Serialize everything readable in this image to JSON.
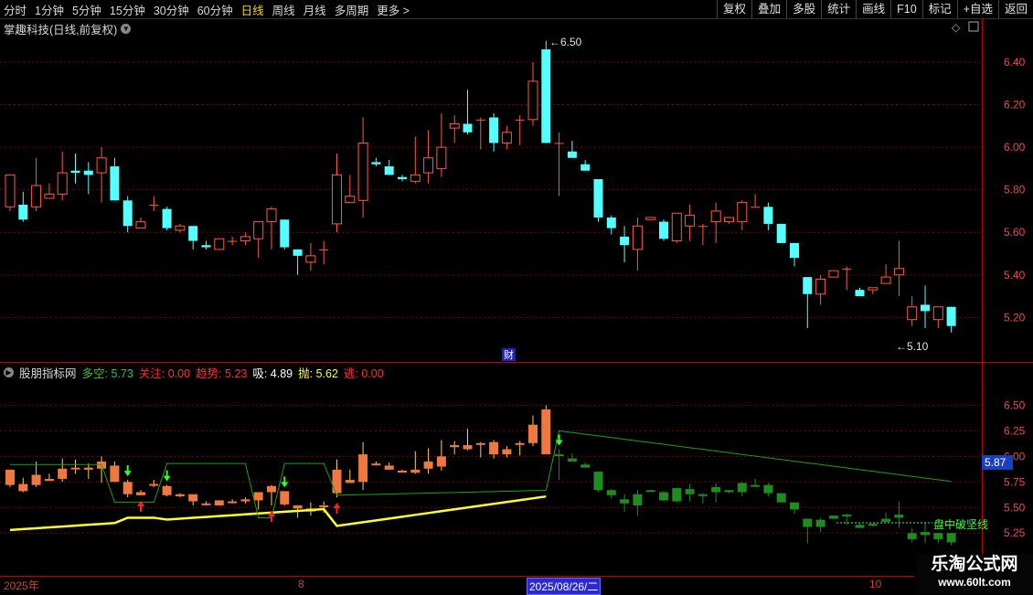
{
  "toolbar": {
    "periods": [
      "分时",
      "1分钟",
      "5分钟",
      "15分钟",
      "30分钟",
      "60分钟",
      "日线",
      "周线",
      "月线",
      "多周期",
      "更多 >"
    ],
    "active_period": "日线",
    "tools": [
      "复权",
      "叠加",
      "多股",
      "统计",
      "画线",
      "F10",
      "标记",
      "+自选",
      "返回"
    ]
  },
  "main_panel": {
    "title": "掌趣科技(日线,前复权)",
    "high_label": "6.50",
    "low_label": "5.10",
    "fin_label": "财",
    "y_ticks": [
      "6.40",
      "6.20",
      "6.00",
      "5.80",
      "5.60",
      "5.40",
      "5.20"
    ]
  },
  "indicator_panel": {
    "name": "股朋指标网",
    "values": [
      {
        "label": "多空:",
        "value": "5.73",
        "color": "#3fbf3f"
      },
      {
        "label": "关注:",
        "value": "0.00",
        "color": "#ff3030"
      },
      {
        "label": "趋势:",
        "value": "5.23",
        "color": "#ff3030"
      },
      {
        "label": "吸:",
        "value": "4.89",
        "color": "#ffffff"
      },
      {
        "label": "抛:",
        "value": "5.62",
        "color": "#ffff40"
      },
      {
        "label": "逃:",
        "value": "0.00",
        "color": "#ff3030"
      }
    ],
    "y_ticks": [
      "6.50",
      "6.25",
      "6.00",
      "5.75",
      "5.50",
      "5.25"
    ],
    "current_price": "5.87",
    "signal_text": "盘中破坚线"
  },
  "date_axis": {
    "labels": [
      "2025年",
      "8",
      "2025/08/26/二",
      "10"
    ]
  },
  "watermark": {
    "line1": "乐淘公式网",
    "line2": "www.60lt.com"
  },
  "colors": {
    "up": "#ff5a3c",
    "down": "#54ffff",
    "grid": "#7a0000",
    "axis": "#ff4040"
  },
  "chart_data": {
    "type": "candlestick",
    "candles": [
      [
        5.72,
        5.87,
        5.86,
        5.7
      ],
      [
        5.73,
        5.66,
        5.79,
        5.65
      ],
      [
        5.72,
        5.82,
        5.95,
        5.7
      ],
      [
        5.76,
        5.78,
        5.83,
        5.76
      ],
      [
        5.78,
        5.88,
        5.98,
        5.75
      ],
      [
        5.89,
        5.88,
        5.97,
        5.83
      ],
      [
        5.89,
        5.87,
        5.93,
        5.78
      ],
      [
        5.88,
        5.95,
        6.0,
        5.74
      ],
      [
        5.91,
        5.75,
        5.95,
        5.75
      ],
      [
        5.75,
        5.63,
        5.77,
        5.6
      ],
      [
        5.62,
        5.65,
        5.67,
        5.62
      ],
      [
        5.73,
        5.73,
        5.77,
        5.7
      ],
      [
        5.71,
        5.62,
        5.72,
        5.61
      ],
      [
        5.61,
        5.63,
        5.64,
        5.6
      ],
      [
        5.63,
        5.56,
        5.63,
        5.52
      ],
      [
        5.54,
        5.53,
        5.56,
        5.52
      ],
      [
        5.52,
        5.57,
        5.57,
        5.53
      ],
      [
        5.56,
        5.56,
        5.58,
        5.54
      ],
      [
        5.56,
        5.58,
        5.6,
        5.54
      ],
      [
        5.57,
        5.65,
        5.65,
        5.48
      ],
      [
        5.65,
        5.71,
        5.72,
        5.52
      ],
      [
        5.66,
        5.53,
        5.66,
        5.52
      ],
      [
        5.52,
        5.49,
        5.52,
        5.4
      ],
      [
        5.46,
        5.49,
        5.55,
        5.42
      ],
      [
        5.52,
        5.52,
        5.56,
        5.45
      ],
      [
        5.64,
        5.87,
        5.97,
        5.6
      ],
      [
        5.74,
        5.77,
        5.87,
        5.76
      ],
      [
        5.75,
        6.02,
        6.14,
        5.67
      ],
      [
        5.93,
        5.92,
        5.95,
        5.91
      ],
      [
        5.91,
        5.87,
        5.94,
        5.87
      ],
      [
        5.86,
        5.85,
        5.87,
        5.84
      ],
      [
        5.84,
        5.87,
        6.05,
        5.83
      ],
      [
        5.88,
        5.95,
        6.08,
        5.83
      ],
      [
        5.9,
        6.0,
        6.16,
        5.86
      ],
      [
        6.09,
        6.11,
        6.15,
        6.02
      ],
      [
        6.11,
        6.07,
        6.27,
        6.06
      ],
      [
        6.13,
        6.13,
        6.14,
        5.99
      ],
      [
        6.14,
        6.02,
        6.16,
        5.98
      ],
      [
        6.02,
        6.07,
        6.1,
        5.99
      ],
      [
        6.13,
        6.13,
        6.15,
        6.01
      ],
      [
        6.13,
        6.31,
        6.4,
        6.1
      ],
      [
        6.46,
        6.02,
        6.5,
        6.02
      ],
      [
        6.02,
        6.02,
        6.07,
        5.77
      ],
      [
        5.98,
        5.95,
        6.03,
        5.95
      ],
      [
        5.92,
        5.89,
        5.94,
        5.89
      ],
      [
        5.85,
        5.67,
        5.85,
        5.65
      ],
      [
        5.67,
        5.62,
        5.68,
        5.59
      ],
      [
        5.58,
        5.54,
        5.63,
        5.46
      ],
      [
        5.52,
        5.63,
        5.67,
        5.42
      ],
      [
        5.66,
        5.67,
        5.67,
        5.66
      ],
      [
        5.65,
        5.57,
        5.66,
        5.56
      ],
      [
        5.56,
        5.69,
        5.67,
        5.55
      ],
      [
        5.63,
        5.68,
        5.73,
        5.56
      ],
      [
        5.63,
        5.63,
        5.64,
        5.54
      ],
      [
        5.65,
        5.7,
        5.74,
        5.55
      ],
      [
        5.65,
        5.67,
        5.65,
        5.64
      ],
      [
        5.65,
        5.74,
        5.75,
        5.61
      ],
      [
        5.72,
        5.72,
        5.78,
        5.72
      ],
      [
        5.72,
        5.64,
        5.74,
        5.61
      ],
      [
        5.64,
        5.55,
        5.64,
        5.55
      ],
      [
        5.55,
        5.48,
        5.53,
        5.44
      ],
      [
        5.39,
        5.31,
        5.39,
        5.15
      ],
      [
        5.31,
        5.38,
        5.4,
        5.26
      ],
      [
        5.39,
        5.42,
        5.41,
        5.39
      ],
      [
        5.43,
        5.43,
        5.44,
        5.33
      ],
      [
        5.33,
        5.3,
        5.34,
        5.3
      ],
      [
        5.33,
        5.34,
        5.34,
        5.31
      ],
      [
        5.36,
        5.39,
        5.45,
        5.37
      ],
      [
        5.4,
        5.43,
        5.56,
        5.3
      ],
      [
        5.19,
        5.25,
        5.3,
        5.16
      ],
      [
        5.26,
        5.23,
        5.35,
        5.15
      ],
      [
        5.19,
        5.25,
        5.25,
        5.15
      ],
      [
        5.25,
        5.16,
        5.25,
        5.13
      ]
    ]
  }
}
